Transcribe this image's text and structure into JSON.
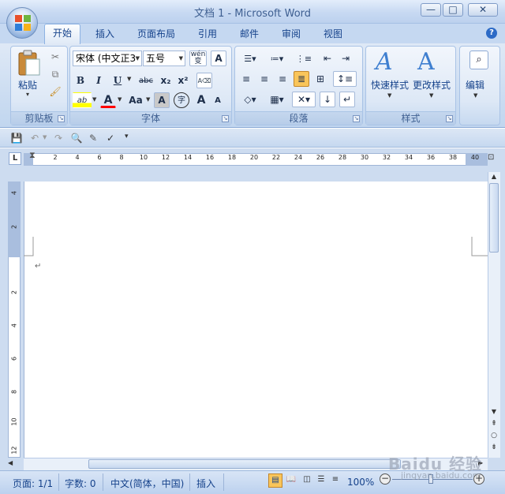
{
  "window": {
    "title": "文档 1 - Microsoft Word",
    "min": "—",
    "max": "□",
    "close": "✕"
  },
  "tabs": [
    "开始",
    "插入",
    "页面布局",
    "引用",
    "邮件",
    "审阅",
    "视图"
  ],
  "help": "?",
  "ribbon": {
    "clipboard": {
      "title": "剪贴板",
      "paste": "粘贴",
      "paste_arrow": "▾"
    },
    "font": {
      "title": "字体",
      "font_name": "宋体 (中文正3",
      "font_size": "五号",
      "ascii": "wén",
      "A": "A",
      "bold": "B",
      "italic": "I",
      "underline": "U",
      "strike": "abc",
      "sub": "x₂",
      "sup": "x²",
      "clear": "A",
      "highlight": "ab",
      "fontcolor": "A",
      "case": "Aa",
      "shading": "A",
      "circle": "字",
      "grow": "A",
      "shrink": "A"
    },
    "paragraph": {
      "title": "段落"
    },
    "styles": {
      "title": "样式",
      "quick": "快速样式",
      "change": "更改样式"
    },
    "editing": {
      "title": "编辑"
    }
  },
  "qat": {
    "more": "▾"
  },
  "ruler": {
    "numbers": [
      "2",
      "4",
      "6",
      "8",
      "10",
      "12",
      "14",
      "16",
      "18",
      "20",
      "22",
      "24",
      "26",
      "28",
      "30",
      "32",
      "34",
      "36",
      "38",
      "40"
    ],
    "tab": "L"
  },
  "vruler": {
    "numbers": [
      "4",
      "2",
      "2",
      "4",
      "6",
      "8",
      "10",
      "12"
    ]
  },
  "doc": {
    "para_mark": "↵"
  },
  "status": {
    "page": "页面: 1/1",
    "words": "字数: 0",
    "lang": "中文(简体，中国)",
    "mode": "插入",
    "zoom": "100%"
  },
  "watermark": {
    "main": "Baidu 经验",
    "sub": "jingyan.baidu.com"
  },
  "colors": {
    "accent": "#15428b",
    "highlight": "#ffff00",
    "fontcolor": "#ff0000"
  }
}
